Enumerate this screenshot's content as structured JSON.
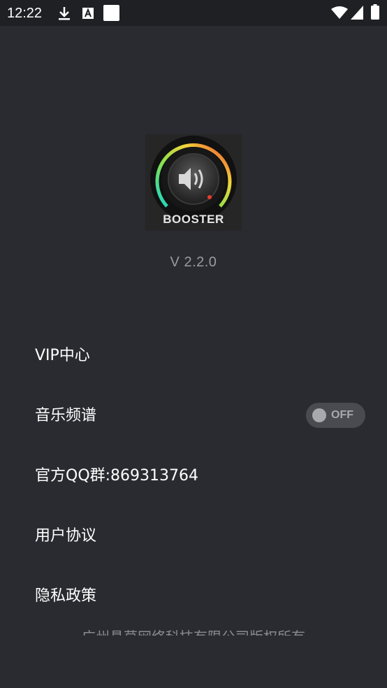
{
  "status_bar": {
    "time": "12:22",
    "icons": [
      "download-icon",
      "font-icon",
      "notification-icon",
      "wifi-icon",
      "signal-icon",
      "battery-icon"
    ]
  },
  "app": {
    "logo_text": "BOOSTER",
    "version": "V 2.2.0"
  },
  "menu": {
    "vip": "VIP中心",
    "spectrum": "音乐频谱",
    "spectrum_toggle": "OFF",
    "qq_group": "官方QQ群:869313764",
    "user_agreement": "用户协议",
    "privacy_policy": "隐私政策"
  },
  "footer": {
    "copyright": "广州悬草网络科技有限公司版权所有"
  },
  "colors": {
    "background": "#2a2b30",
    "status_bar": "#1f2024",
    "text_primary": "#ffffff",
    "text_secondary": "#9a9ba0",
    "toggle_off_track": "#4a4b50",
    "toggle_off_knob": "#a8a9ad"
  }
}
